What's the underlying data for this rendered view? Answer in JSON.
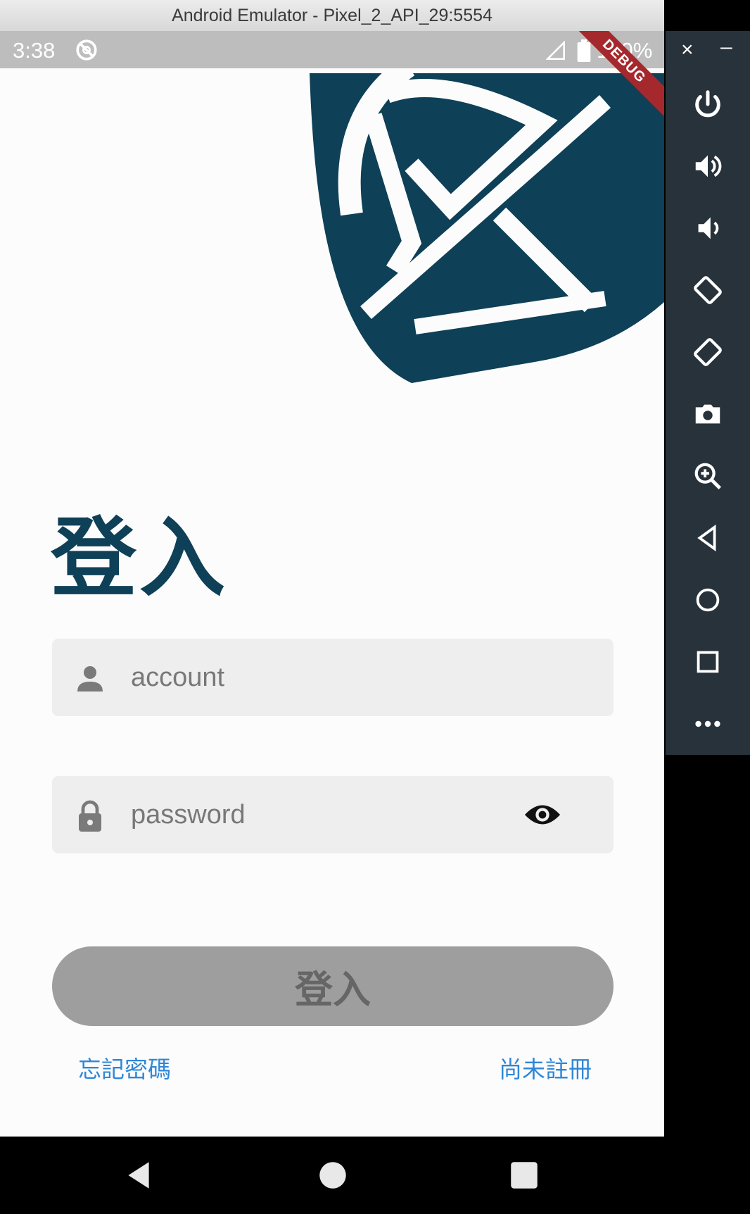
{
  "window": {
    "title": "Android Emulator - Pixel_2_API_29:5554"
  },
  "status_bar": {
    "time": "3:38",
    "battery": "100%",
    "debug_label": "DEBUG"
  },
  "login": {
    "title": "登入",
    "account_placeholder": "account",
    "password_placeholder": "password",
    "submit_label": "登入",
    "forgot_password": "忘記密碼",
    "register": "尚未註冊"
  },
  "emulator_controls": {
    "close": "×",
    "minimize": "–",
    "icons": [
      "power-icon",
      "volume-up-icon",
      "volume-down-icon",
      "rotate-left-icon",
      "rotate-right-icon",
      "camera-icon",
      "zoom-icon",
      "back-icon",
      "home-icon",
      "overview-icon",
      "more-icon"
    ]
  },
  "colors": {
    "brand": "#0e4057",
    "button_disabled": "#9e9e9e",
    "link": "#2f87d8",
    "debug_ribbon": "#a5282d"
  }
}
